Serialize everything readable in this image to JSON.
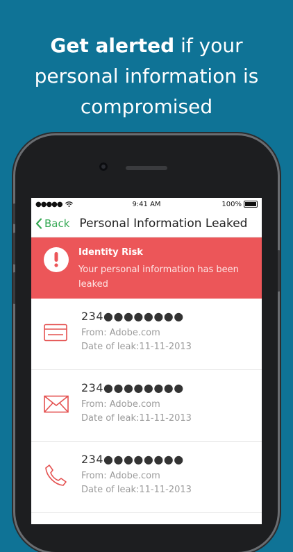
{
  "headline": {
    "bold": "Get alerted",
    "rest_line1": "if your",
    "line2": "personal information is",
    "line3": "compromised"
  },
  "status_bar": {
    "signal": "●●●●●",
    "time": "9:41 AM",
    "battery": "100%"
  },
  "nav": {
    "back_label": "Back",
    "title": "Personal Information Leaked"
  },
  "alert": {
    "title": "Identity Risk",
    "message": "Your personal information has been leaked",
    "color": "#ec5659"
  },
  "items": [
    {
      "icon": "credit-card-icon",
      "value": "234●●●●●●●●",
      "from": "From: Adobe.com",
      "date": "Date of leak:11-11-2013"
    },
    {
      "icon": "envelope-icon",
      "value": "234●●●●●●●●",
      "from": "From: Adobe.com",
      "date": "Date of leak:11-11-2013"
    },
    {
      "icon": "phone-icon",
      "value": "234●●●●●●●●",
      "from": "From: Adobe.com",
      "date": "Date of leak:11-11-2013"
    }
  ],
  "colors": {
    "background": "#0f7396",
    "accent_green": "#34a853",
    "icon_red": "#e4504f"
  }
}
